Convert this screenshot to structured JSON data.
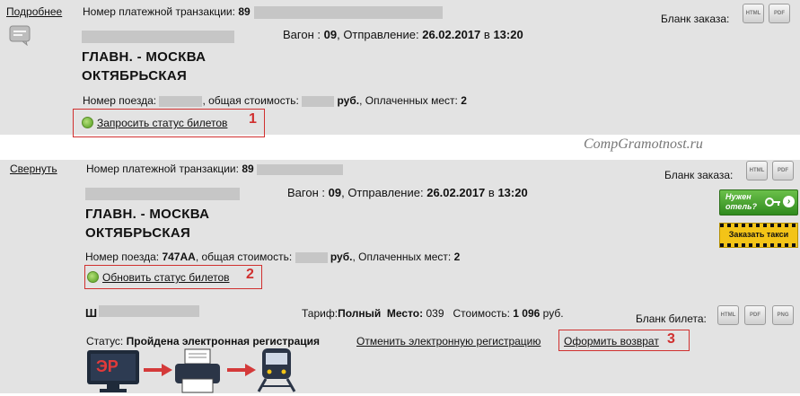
{
  "order1": {
    "toggle_label": "Подробнее",
    "txn_label": "Номер платежной транзакции:",
    "txn_prefix": "89",
    "wagon_label": "Вагон :",
    "wagon_value": "09",
    "departure_label": ", Отправление:",
    "departure_date": "26.02.2017",
    "departure_in": "в",
    "departure_time": "13:20",
    "route_from": "ГЛАВН. - МОСКВА",
    "route_to": "ОКТЯБРЬСКАЯ",
    "train_label": "Номер поезда:",
    "cost_label": ", общая стоимость:",
    "currency": "руб.",
    "paid_label": ", Оплаченных мест:",
    "paid_value": "2",
    "form_label": "Бланк заказа:",
    "status_action": "Запросить статус билетов",
    "marker": "1"
  },
  "watermark": "CompGramotnost.ru",
  "order2": {
    "toggle_label": "Свернуть",
    "txn_label": "Номер платежной транзакции:",
    "txn_prefix": "89",
    "wagon_label": "Вагон :",
    "wagon_value": "09",
    "departure_label": ", Отправление:",
    "departure_date": "26.02.2017",
    "departure_in": "в",
    "departure_time": "13:20",
    "route_from": "ГЛАВН. - МОСКВА",
    "route_to": "ОКТЯБРЬСКАЯ",
    "train_label": "Номер поезда:",
    "train_value": "747АА",
    "cost_label": ", общая стоимость:",
    "currency": "руб.",
    "paid_label": ", Оплаченных мест:",
    "paid_value": "2",
    "form_label": "Бланк заказа:",
    "status_action": "Обновить статус билетов",
    "marker": "2",
    "promo_hotel": "Нужен отель?",
    "promo_taxi": "Заказать такси",
    "ticket": {
      "passenger_initial": "Ш",
      "tariff_label": "Тариф:",
      "tariff_value": "Полный",
      "seat_label": "Место:",
      "seat_value": "039",
      "cost_label": "Стоимость:",
      "cost_value": "1 096",
      "currency": "руб.",
      "form_label": "Бланк билета:",
      "status_label": "Статус:",
      "status_value": "Пройдена электронная регистрация",
      "cancel_reg": "Отменить электронную регистрацию",
      "refund": "Оформить возврат",
      "marker": "3",
      "er_badge": "ЭР"
    }
  },
  "format_buttons": [
    "HTML",
    "PDF",
    "PNG"
  ],
  "colors": {
    "panel_bg": "#e3e3e3",
    "redaction": "#c6c6c6",
    "annotation_red": "#d0302f",
    "promo_green": "#3c9b25",
    "taxi_yellow": "#f3c417",
    "diagram_arrow": "#d43a3a",
    "monitor_dark": "#1f2a3a"
  }
}
